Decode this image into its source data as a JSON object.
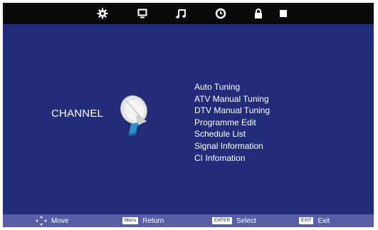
{
  "top_menu": {
    "icons": [
      "settings-gear-icon",
      "monitor-icon",
      "music-note-icon",
      "clock-icon",
      "lock-icon",
      "square-icon"
    ]
  },
  "page": {
    "title": "CHANNEL"
  },
  "menu": {
    "items": [
      "Auto Tuning",
      "ATV Manual Tuning",
      "DTV Manual Tuning",
      "Programme Edit",
      "Schedule List",
      "Signal Information",
      "CI Infomation"
    ]
  },
  "footer": {
    "move": "Move",
    "menu_key": "Menu",
    "return": "Return",
    "enter_key": "ENTER",
    "select": "Select",
    "exit_key": "EXIT",
    "exit": "Exit"
  },
  "colors": {
    "background": "#222c7b",
    "top_bar": "#0b0b0b",
    "bottom_bar": "#595fa5",
    "text": "#ffffff"
  }
}
